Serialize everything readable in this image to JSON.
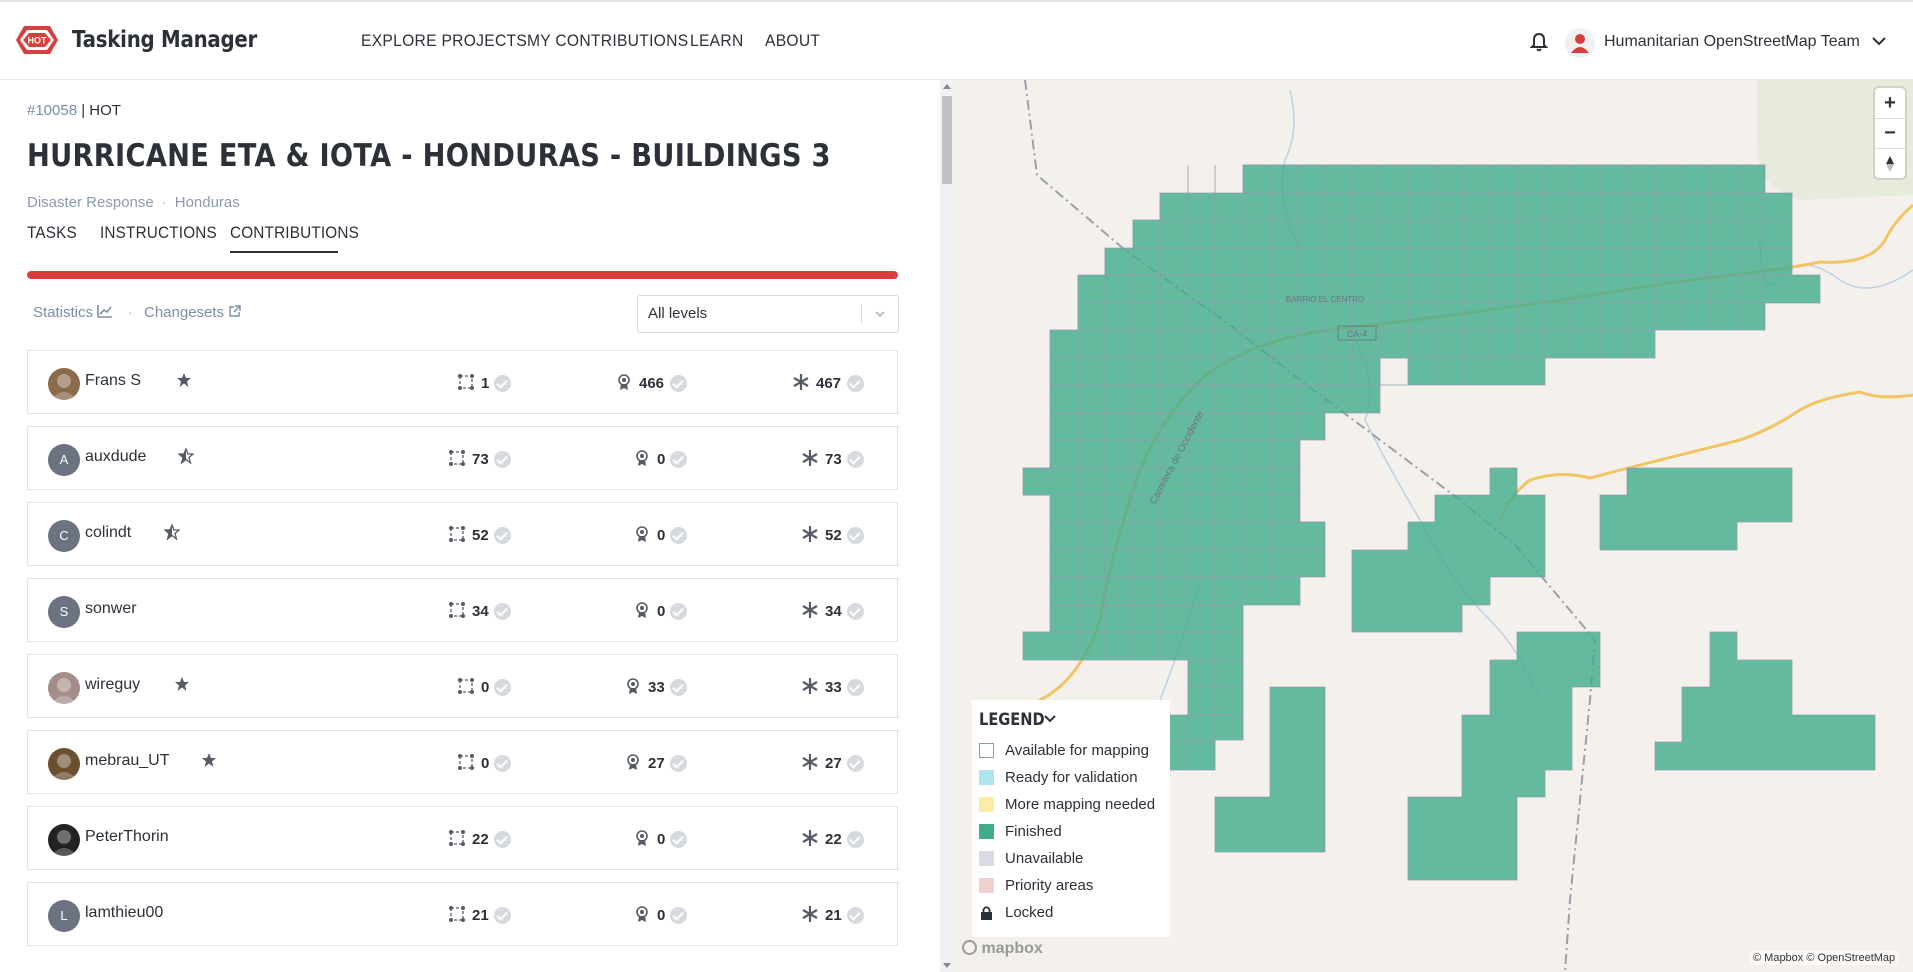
{
  "header": {
    "brand": "Tasking Manager",
    "logo_text": "HOT",
    "nav": [
      "EXPLORE PROJECTS",
      "MY CONTRIBUTIONS",
      "LEARN",
      "ABOUT"
    ],
    "user_name": "Humanitarian OpenStreetMap Team"
  },
  "project": {
    "id": "#10058",
    "org": "| HOT",
    "title": "HURRICANE ETA & IOTA - HONDURAS - BUILDINGS 3",
    "tags": [
      "Disaster Response",
      "Honduras"
    ],
    "tabs": [
      "TASKS",
      "INSTRUCTIONS",
      "CONTRIBUTIONS"
    ],
    "active_tab": "CONTRIBUTIONS",
    "progress_color": "#d73f3f"
  },
  "contributions": {
    "statistics_label": "Statistics",
    "changesets_label": "Changesets",
    "filter_value": "All levels",
    "rows": [
      {
        "name": "Frans S",
        "initial": "",
        "photo": true,
        "star": "filled",
        "mapped": "1",
        "validated": "466",
        "total": "467"
      },
      {
        "name": "auxdude",
        "initial": "A",
        "photo": false,
        "star": "half",
        "mapped": "73",
        "validated": "0",
        "total": "73"
      },
      {
        "name": "colindt",
        "initial": "C",
        "photo": false,
        "star": "half",
        "mapped": "52",
        "validated": "0",
        "total": "52"
      },
      {
        "name": "sonwer",
        "initial": "S",
        "photo": false,
        "star": "none",
        "mapped": "34",
        "validated": "0",
        "total": "34"
      },
      {
        "name": "wireguy",
        "initial": "",
        "photo": true,
        "star": "filled",
        "mapped": "0",
        "validated": "33",
        "total": "33"
      },
      {
        "name": "mebrau_UT",
        "initial": "",
        "photo": true,
        "star": "filled",
        "mapped": "0",
        "validated": "27",
        "total": "27"
      },
      {
        "name": "PeterThorin",
        "initial": "",
        "photo": true,
        "star": "none",
        "mapped": "22",
        "validated": "0",
        "total": "22"
      },
      {
        "name": "lamthieu00",
        "initial": "L",
        "photo": false,
        "star": "none",
        "mapped": "21",
        "validated": "0",
        "total": "21"
      }
    ]
  },
  "map": {
    "place_label": "BARRIO EL CENTRO",
    "road_label": "CA-4",
    "road_name": "Carretera de Occidente",
    "zoom_in": "+",
    "zoom_out": "−",
    "legend_title": "LEGEND",
    "legend": [
      {
        "label": "Available for mapping",
        "color": "#ffffff"
      },
      {
        "label": "Ready for validation",
        "color": "#ade6ef"
      },
      {
        "label": "More mapping needed",
        "color": "#fceca4"
      },
      {
        "label": "Finished",
        "color": "#40ac8c"
      },
      {
        "label": "Unavailable",
        "color": "#d8dae4"
      },
      {
        "label": "Priority areas",
        "color": "#efd1d1"
      },
      {
        "label": "Locked",
        "color": "lock-icon"
      }
    ],
    "mapbox_logo": "mapbox",
    "attribution": "© Mapbox © OpenStreetMap"
  }
}
